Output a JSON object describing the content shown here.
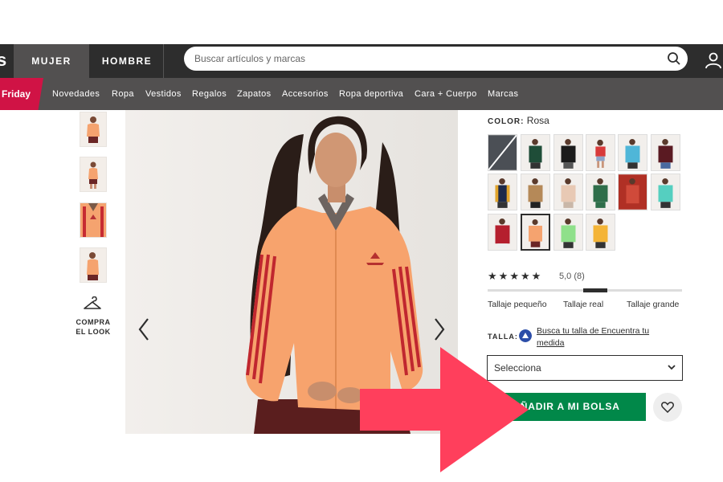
{
  "header": {
    "logo_fragment": "s",
    "tabs": [
      {
        "label": "MUJER"
      },
      {
        "label": "HOMBRE"
      }
    ],
    "search_placeholder": "Buscar artículos y marcas",
    "icons": [
      "search-icon",
      "user-icon"
    ]
  },
  "nav": {
    "promo": "Friday",
    "promo_color": "#d01345",
    "items": [
      "Novedades",
      "Ropa",
      "Vestidos",
      "Regalos",
      "Zapatos",
      "Accesorios",
      "Ropa deportiva",
      "Cara + Cuerpo",
      "Marcas"
    ]
  },
  "gallery": {
    "thumbnail_count": 4,
    "shop_look": "COMPRA EL LOOK",
    "icons": [
      "hanger-icon",
      "chevron-left-icon",
      "chevron-right-icon"
    ]
  },
  "product": {
    "color_label": "COLOR:",
    "color_value": "Rosa",
    "swatch_count": 16,
    "selected_swatch_index": 13,
    "rating": {
      "stars_filled": 5,
      "stars_max": 5,
      "value_text": "5,0",
      "count_text": "(8)"
    },
    "fit": {
      "labels": [
        "Tallaje pequeño",
        "Tallaje real",
        "Tallaje grande"
      ],
      "position": 0.5
    },
    "size_label": "TALLA:",
    "size_help_link": "Busca tu talla de Encuentra tu medida",
    "size_select_value": "Selecciona",
    "add_button": "AÑADIR A MI BOLSA",
    "add_button_color": "#018849",
    "icons": [
      "heart-icon",
      "chevron-down-icon",
      "fit-assistant-icon"
    ]
  },
  "annotation": {
    "arrow_color": "#ff3f5c"
  }
}
